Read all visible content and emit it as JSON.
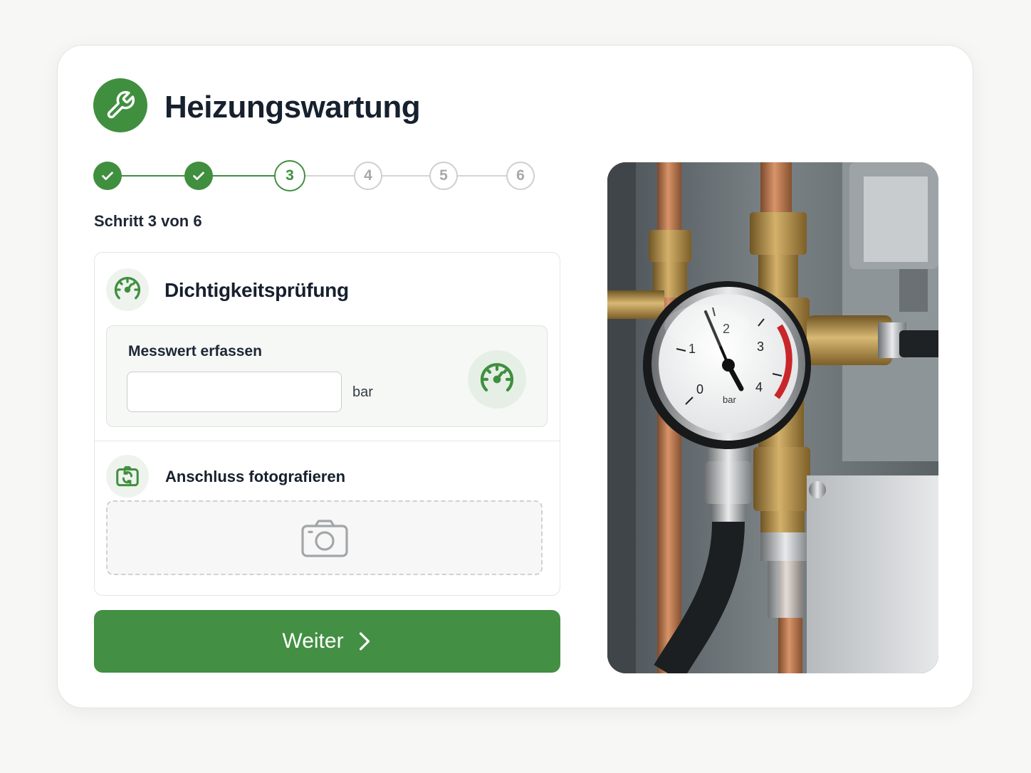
{
  "app": {
    "title": "Heizungswartung",
    "icon": "wrench-icon",
    "accent_color": "#3f8f3f"
  },
  "stepper": {
    "current": 3,
    "total": 6,
    "label": "Schritt 3 von 6",
    "steps": [
      {
        "label": "1",
        "state": "done"
      },
      {
        "label": "2",
        "state": "done"
      },
      {
        "label": "3",
        "state": "active"
      },
      {
        "label": "4",
        "state": "todo"
      },
      {
        "label": "5",
        "state": "todo"
      },
      {
        "label": "6",
        "state": "todo"
      }
    ]
  },
  "task": {
    "title": "Dichtigkeitsprüfung",
    "icon": "gauge-icon",
    "measurement": {
      "label": "Messwert erfassen",
      "value": "",
      "placeholder": "",
      "unit": "bar",
      "action_icon": "gauge-icon"
    },
    "photo": {
      "title": "Anschluss fotografieren",
      "icon": "camera-rotate-icon",
      "drop_icon": "camera-icon"
    }
  },
  "actions": {
    "next_label": "Weiter",
    "next_icon": "chevron-right-icon"
  },
  "image": {
    "subject": "pressure-gauge-photo",
    "gauge_unit": "bar",
    "gauge_ticks": [
      "0",
      "1",
      "2",
      "3",
      "4"
    ]
  }
}
